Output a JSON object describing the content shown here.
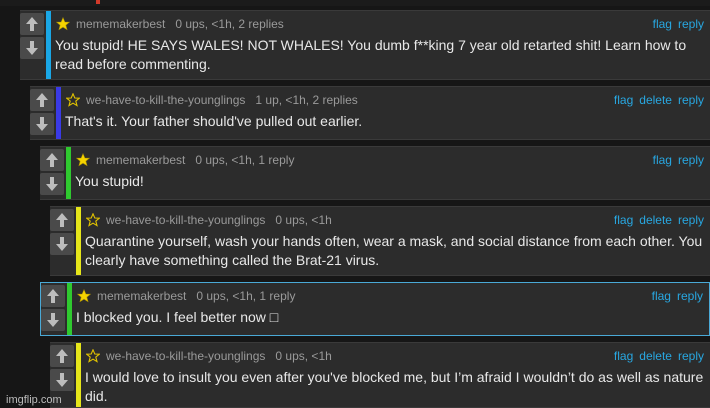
{
  "comments": [
    {
      "username": "mememakerbest",
      "meta": "0 ups, <1h, 2 replies",
      "text": "You stupid! HE SAYS WALES! NOT WHALES! You dumb f**king 7 year old retarted shit! Learn how to read before commenting.",
      "bar_color": "#1aa7e6",
      "star": "filled",
      "actions": [
        "flag",
        "reply"
      ]
    },
    {
      "username": "we-have-to-kill-the-younglings",
      "meta": "1 up, <1h, 2 replies",
      "text": "That's it. Your father should've pulled out earlier.",
      "bar_color": "#3a3ae6",
      "star": "outline",
      "actions": [
        "flag",
        "delete",
        "reply"
      ]
    },
    {
      "username": "mememakerbest",
      "meta": "0 ups, <1h, 1 reply",
      "text": "You stupid!",
      "bar_color": "#2fc92f",
      "star": "filled",
      "actions": [
        "flag",
        "reply"
      ]
    },
    {
      "username": "we-have-to-kill-the-younglings",
      "meta": "0 ups, <1h",
      "text": "Quarantine yourself, wash your hands often, wear a mask, and social distance from each other. You clearly have something called the Brat-21 virus.",
      "bar_color": "#e6e61a",
      "star": "outline",
      "actions": [
        "flag",
        "delete",
        "reply"
      ]
    },
    {
      "username": "mememakerbest",
      "meta": "0 ups, <1h, 1 reply",
      "text": "I blocked you. I feel better now □",
      "bar_color": "#2fc92f",
      "star": "filled",
      "actions": [
        "flag",
        "reply"
      ]
    },
    {
      "username": "we-have-to-kill-the-younglings",
      "meta": "0 ups, <1h",
      "text": "I would love to insult you even after you've blocked me, but I’m afraid I wouldn’t do as well as nature did.",
      "bar_color": "#e6e61a",
      "star": "outline",
      "actions": [
        "flag",
        "delete",
        "reply"
      ]
    }
  ],
  "icons": {
    "upvote": "arrow-up-icon",
    "downvote": "arrow-down-icon",
    "star_filled": "star-filled-icon",
    "star_outline": "star-outline-icon"
  },
  "watermark": "imgflip.com"
}
